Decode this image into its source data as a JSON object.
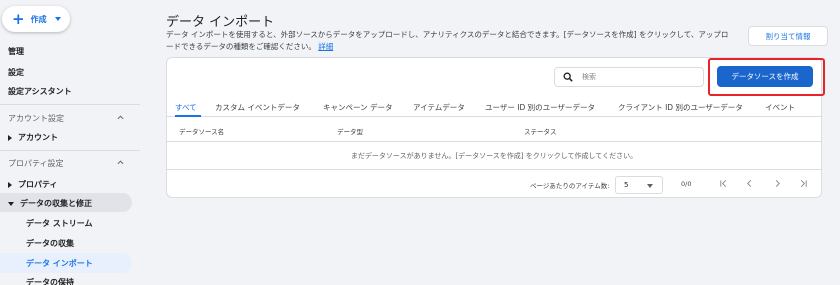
{
  "sidebar": {
    "create_label": "作成",
    "items_top": [
      "管理",
      "設定",
      "設定アシスタント"
    ],
    "account_section": "アカウント設定",
    "account_item": "アカウント",
    "property_section": "プロパティ設定",
    "property_item": "プロパティ",
    "data_group": "データの収集と修正",
    "leaves": [
      "データ ストリーム",
      "データの収集",
      "データ インポート",
      "データの保持"
    ]
  },
  "header": {
    "title": "データ インポート",
    "description": "データ インポートを使用すると、外部ソースからデータをアップロードし、アナリティクスのデータと結合できます。[データソースを作成] をクリックして、アップロードできるデータの種類をご確認ください。",
    "link": "詳細",
    "quota_button": "割り当て情報"
  },
  "card": {
    "search_placeholder": "検索",
    "create_button": "データソースを作成",
    "tabs": [
      "すべて",
      "カスタム イベントデータ",
      "キャンペーン データ",
      "アイテムデータ",
      "ユーザー ID 別のユーザーデータ",
      "クライアント ID 別のユーザーデータ",
      "イベント"
    ],
    "columns": [
      "データソース名",
      "データ型",
      "ステータス"
    ],
    "empty_message": "まだデータソースがありません。[データソースを作成] をクリックして作成してください。",
    "pager": {
      "items_per_page_label": "ページあたりのアイテム数:",
      "page_size": "5",
      "range": "0/0"
    }
  },
  "colors": {
    "accent": "#1a73e8",
    "primary_button": "#1a66cc",
    "highlight_border": "#e5252a",
    "background": "#f1f3f6"
  },
  "icons": [
    "plus-icon",
    "chevron-down-icon",
    "chevron-up-icon",
    "search-icon",
    "first-page-icon",
    "prev-page-icon",
    "next-page-icon",
    "last-page-icon"
  ]
}
